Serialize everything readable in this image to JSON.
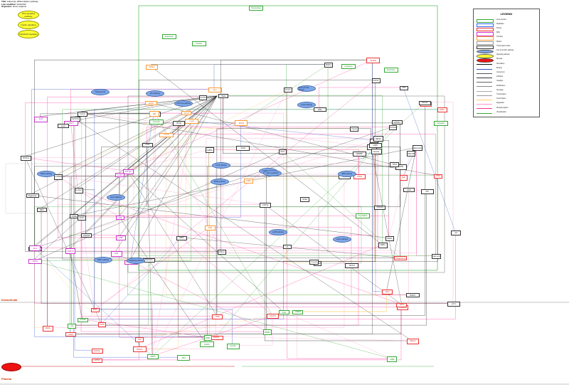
{
  "header": {
    "title_label": "Title:",
    "title_value": "Adipocyte differentiation pathway",
    "modified_label": "Last modified:",
    "modified_value": "3/21/2012",
    "organism_label": "Organism:",
    "organism_value": "Homo sapiens"
  },
  "yellow_ovals": [
    "Wnt signaling pathway",
    "Insulin signaling",
    "Metabolic signaling"
  ],
  "compartments": {
    "intracellular": "Intracellular",
    "plasma": "Plasma"
  },
  "legend": {
    "title": "LEGEND",
    "rows": [
      {
        "label": "Gene product",
        "color": "#33aa33",
        "kind": "box"
      },
      {
        "label": "Metabolite",
        "color": "#3366ff",
        "kind": "box"
      },
      {
        "label": "Protein",
        "color": "#ee3333",
        "kind": "box"
      },
      {
        "label": "RNA",
        "color": "#cc33cc",
        "kind": "box"
      },
      {
        "label": "Complex",
        "color": "#ff9933",
        "kind": "box"
      },
      {
        "label": "Mutant",
        "color": "#999999",
        "kind": "box"
      },
      {
        "label": "Transcription factor",
        "color": "#333333",
        "kind": "box"
      },
      {
        "label": "Link to another pathway",
        "color": "#7fa8e6",
        "kind": "oval"
      },
      {
        "label": "Signaling pathway",
        "color": "#ffff33",
        "kind": "oval"
      },
      {
        "label": "Disease",
        "color": "#ee1111",
        "kind": "oval"
      },
      {
        "label": "Stimulation",
        "color": "#111111",
        "kind": "line"
      },
      {
        "label": "Binding",
        "color": "#3355cc",
        "kind": "line"
      },
      {
        "label": "Conversion",
        "color": "#555555",
        "kind": "line"
      },
      {
        "label": "Inhibition",
        "color": "#333333",
        "kind": "line"
      },
      {
        "label": "Catalysis",
        "color": "#666666",
        "kind": "line"
      },
      {
        "label": "Modification",
        "color": "#888888",
        "kind": "line"
      },
      {
        "label": "Cleavage",
        "color": "#aaaaaa",
        "kind": "line"
      },
      {
        "label": "Translocation",
        "color": "#999999",
        "kind": "line"
      },
      {
        "label": "Transcription",
        "color": "#ffcc66",
        "kind": "line"
      },
      {
        "label": "Regulation",
        "color": "#ff99cc",
        "kind": "line"
      },
      {
        "label": "Phosphorylation",
        "color": "#ff3399",
        "kind": "line"
      },
      {
        "label": "Ubiquitination",
        "color": "#33aa33",
        "kind": "line"
      }
    ]
  },
  "pathway_links": [
    "Wnt pathway",
    "TGF-beta pathway",
    "Insulin pathway",
    "MAPK pathway",
    "Notch pathway",
    "Hedgehog pathway",
    "FoxO pathway",
    "PPAR pathway",
    "mTOR pathway",
    "BMP pathway",
    "cAMP pathway",
    "AMPK pathway",
    "Leptin pathway",
    "Adipogenesis",
    "Glucocorticoid pathway",
    "Lipid metabolism"
  ],
  "genes": [
    "PPARG",
    "CEBPA",
    "CEBPB",
    "CEBPD",
    "SREBF1",
    "KLF5",
    "KLF15",
    "GATA2",
    "GATA3",
    "WNT10B",
    "CTNNB1",
    "FZD1",
    "LRP5",
    "GSK3B",
    "AXIN1",
    "TCF7L2",
    "INSR",
    "IRS1",
    "PIK3CA",
    "AKT1",
    "FOXO1",
    "MTOR",
    "RPS6KB1",
    "CREB1",
    "PRKACA",
    "NR3C1",
    "SMAD3",
    "BMP2",
    "BMP4",
    "SMAD1",
    "NOTCH1",
    "HES1",
    "SHH",
    "GLI1",
    "LEP",
    "ADIPOQ",
    "FABP4",
    "LPL",
    "PLIN1",
    "CD36",
    "SLC2A4",
    "RXRA",
    "NCOA1",
    "NCOA2",
    "HDAC3",
    "SIRT1",
    "EP300",
    "CREBBP",
    "MED1",
    "ZNF423",
    "EBF1",
    "DLK1",
    "RORA",
    "NRIP1",
    "ESR1",
    "IRS2",
    "PTEN",
    "MAPK1",
    "MAPK3",
    "MAP2K1",
    "RAF1",
    "HRAS",
    "SOS1",
    "GRB2",
    "SHC1",
    "IGF1",
    "IGF1R",
    "INS",
    "TNF",
    "IL6",
    "STAT3",
    "STAT5A",
    "JAK2",
    "JAK1",
    "CDK4",
    "CCND1",
    "RB1",
    "E2F1",
    "TP53",
    "CDKN1A",
    "CDKN1B",
    "FGF2",
    "FGF10",
    "FGFR1",
    "PDGFB",
    "EGF",
    "EGFR",
    "MEF2A",
    "NFATC1",
    "CALM1",
    "PPP3CA",
    "PRKCA",
    "PLCG1",
    "IP3",
    "DAG",
    "cAMP",
    "Ca2+",
    "Glucose",
    "Insulin",
    "Fatty acid",
    "Triglyceride",
    "Glucocorticoid",
    "Dexamethasone",
    "IBMX",
    "Rosiglitazone",
    "Retinoic acid",
    "Leptin",
    "Adiponectin",
    "Resistin",
    "Visfatin",
    "Apelin",
    "Chemerin",
    "Omentin"
  ],
  "misc_labels": [
    "Translocation",
    "Expression",
    "Nucleus",
    "Cytoplasm",
    "Membrane",
    "Secretion",
    "Degradation",
    "Activation"
  ]
}
